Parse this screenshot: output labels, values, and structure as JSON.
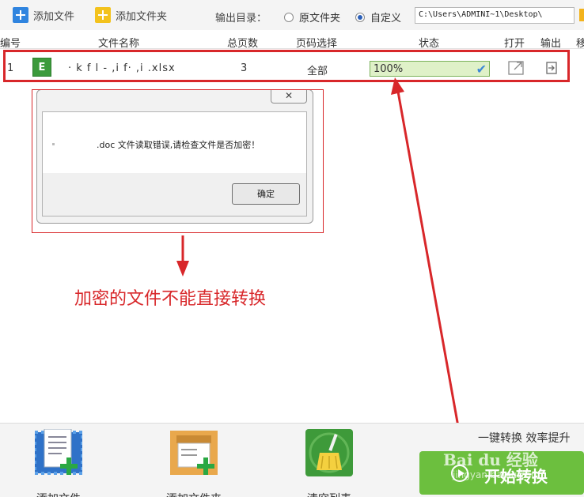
{
  "toolbar": {
    "add_file": "添加文件",
    "add_folder": "添加文件夹",
    "output_label": "输出目录：",
    "radio_original": "原文件夹",
    "radio_custom": "自定义",
    "output_path": "C:\\Users\\ADMINI~1\\Desktop\\"
  },
  "table": {
    "headers": {
      "index": "编号",
      "filename": "文件名称",
      "pages": "总页数",
      "page_select": "页码选择",
      "status": "状态",
      "open": "打开",
      "output": "输出",
      "move": "移"
    },
    "rows": [
      {
        "index": "1",
        "type_badge": "E",
        "filename": "· k f  l - ,i f· ,i .xlsx",
        "pages": "3",
        "page_select": "全部",
        "status": "100%"
      }
    ]
  },
  "dialog": {
    "close_symbol": "✕",
    "message": ".doc 文件读取错误,请检查文件是否加密！",
    "ok": "确定"
  },
  "annotation": "加密的文件不能直接转换",
  "bottom": {
    "add_file": "添加文件",
    "add_folder": "添加文件夹",
    "clear_list": "清空列表",
    "slogan": "一键转换  效率提升",
    "start": "开始转换",
    "watermark": "Bai du 经验",
    "watermark_sub": "jingyan.baidu.com"
  },
  "colors": {
    "highlight_red": "#d8272a",
    "start_green": "#6cbf3e",
    "progress_fill": "#dff1c8"
  }
}
